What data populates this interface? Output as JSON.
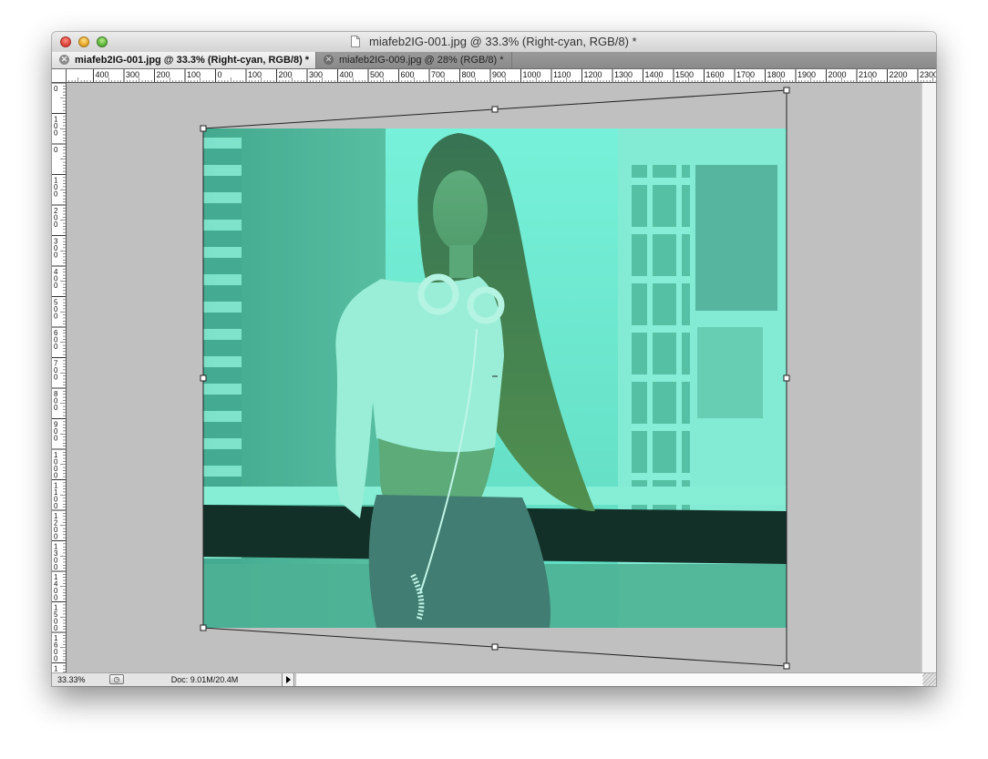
{
  "window": {
    "title": "miafeb2IG-001.jpg @ 33.3% (Right-cyan, RGB/8) *"
  },
  "tabs": [
    {
      "label": "miafeb2IG-001.jpg @ 33.3% (Right-cyan, RGB/8) *",
      "active": true
    },
    {
      "label": "miafeb2IG-009.jpg @ 28% (RGB/8) *",
      "active": false
    }
  ],
  "ruler": {
    "horizontal_labels": [
      "",
      "400",
      "300",
      "200",
      "100",
      "0",
      "100",
      "200",
      "300",
      "400",
      "500",
      "600",
      "700",
      "800",
      "900",
      "1000",
      "1100",
      "1200",
      "1300",
      "1400",
      "1500",
      "1600",
      "1700",
      "1800",
      "1900",
      "2000",
      "2100",
      "2200",
      "2300"
    ],
    "vertical_labels": [
      "0",
      "100",
      "0",
      "100",
      "200",
      "300",
      "400",
      "500",
      "600",
      "700",
      "800",
      "900",
      "1000",
      "1100",
      "1200",
      "1300",
      "1400",
      "1500",
      "1600",
      "1700"
    ]
  },
  "document": {
    "channel_tint": "#5fe8c8"
  },
  "status": {
    "zoom": "33.33%",
    "doc_info": "Doc: 9.01M/20.4M"
  },
  "colors": {
    "canvas_background": "#c0c0c0",
    "close_light": "#e0443a",
    "minimize_light": "#e8a92b",
    "zoom_light": "#5fb83a"
  }
}
